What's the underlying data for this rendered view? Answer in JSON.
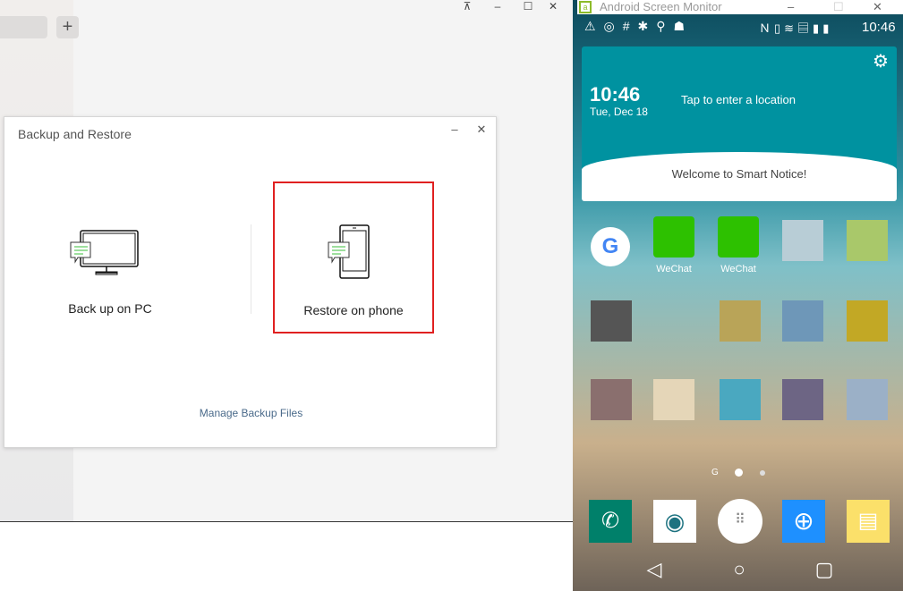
{
  "app": {
    "add_label": "+",
    "window_controls": [
      "pin",
      "minimize",
      "maximize",
      "close"
    ]
  },
  "dialog": {
    "title": "Backup and Restore",
    "minimize": "–",
    "close": "✕",
    "options": [
      {
        "label": "Back up on PC",
        "icon": "monitor-chat-icon"
      },
      {
        "label": "Restore on phone",
        "icon": "phone-chat-icon",
        "highlighted": true
      }
    ],
    "manage_link": "Manage Backup Files",
    "highlight_color": "#e02020"
  },
  "monitor": {
    "title": "Android Screen Monitor",
    "status_bar": {
      "left_icons": [
        "warning",
        "app",
        "hash",
        "settings",
        "usb",
        "android"
      ],
      "right_icons": [
        "nfc",
        "vibrate",
        "wifi",
        "sd-card",
        "signal",
        "battery"
      ],
      "time": "10:46"
    },
    "widget": {
      "time": "10:46",
      "date": "Tue, Dec 18",
      "location": "Tap to enter a location",
      "welcome": "Welcome to Smart Notice!"
    },
    "apps": [
      {
        "name": "Google",
        "label": ""
      },
      {
        "name": "WeChat",
        "label": "WeChat"
      },
      {
        "name": "WeChat",
        "label": "WeChat"
      }
    ],
    "page_indicator": {
      "pages": 2,
      "current": 1
    },
    "dock": [
      "phone",
      "contacts",
      "apps",
      "browser",
      "memo"
    ],
    "nav": [
      "back",
      "home",
      "recents"
    ]
  }
}
